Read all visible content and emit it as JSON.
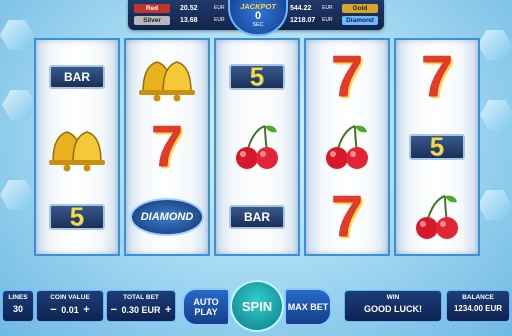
{
  "jackpot": {
    "title": "JACKPOT",
    "timer": "0",
    "timer_unit": "SEC",
    "left": [
      {
        "name": "Red",
        "value": "20.52",
        "currency": "EUR",
        "color": "#c0352c"
      },
      {
        "name": "Silver",
        "value": "13.68",
        "currency": "EUR",
        "color": "#b9b9b9"
      }
    ],
    "right": [
      {
        "name": "Gold",
        "value": "544.22",
        "currency": "EUR",
        "color": "#d9a52c"
      },
      {
        "name": "Diamond",
        "value": "1218.07",
        "currency": "EUR",
        "color": "#6fb8ff"
      }
    ]
  },
  "reels": [
    [
      "BAR",
      "bells",
      "5"
    ],
    [
      "bells",
      "7",
      "DIAMOND"
    ],
    [
      "5",
      "cherries",
      "BAR"
    ],
    [
      "7",
      "cherries",
      "7"
    ],
    [
      "7",
      "5",
      "cherries"
    ]
  ],
  "symbols": {
    "bar": "BAR",
    "five": "5",
    "diamond": "DIAMOND",
    "seven": "7"
  },
  "controls": {
    "lines_label": "LINES",
    "lines_value": "30",
    "coin_label": "COIN VALUE",
    "coin_value": "0.01",
    "totalbet_label": "TOTAL BET",
    "totalbet_value": "0.30 EUR",
    "minus": "−",
    "plus": "+",
    "autoplay": "AUTO PLAY",
    "spin": "SPIN",
    "maxbet": "MAX BET",
    "win_label": "WIN",
    "win_value": "GOOD LUCK!",
    "balance_label": "BALANCE",
    "balance_value": "1234.00 EUR"
  }
}
